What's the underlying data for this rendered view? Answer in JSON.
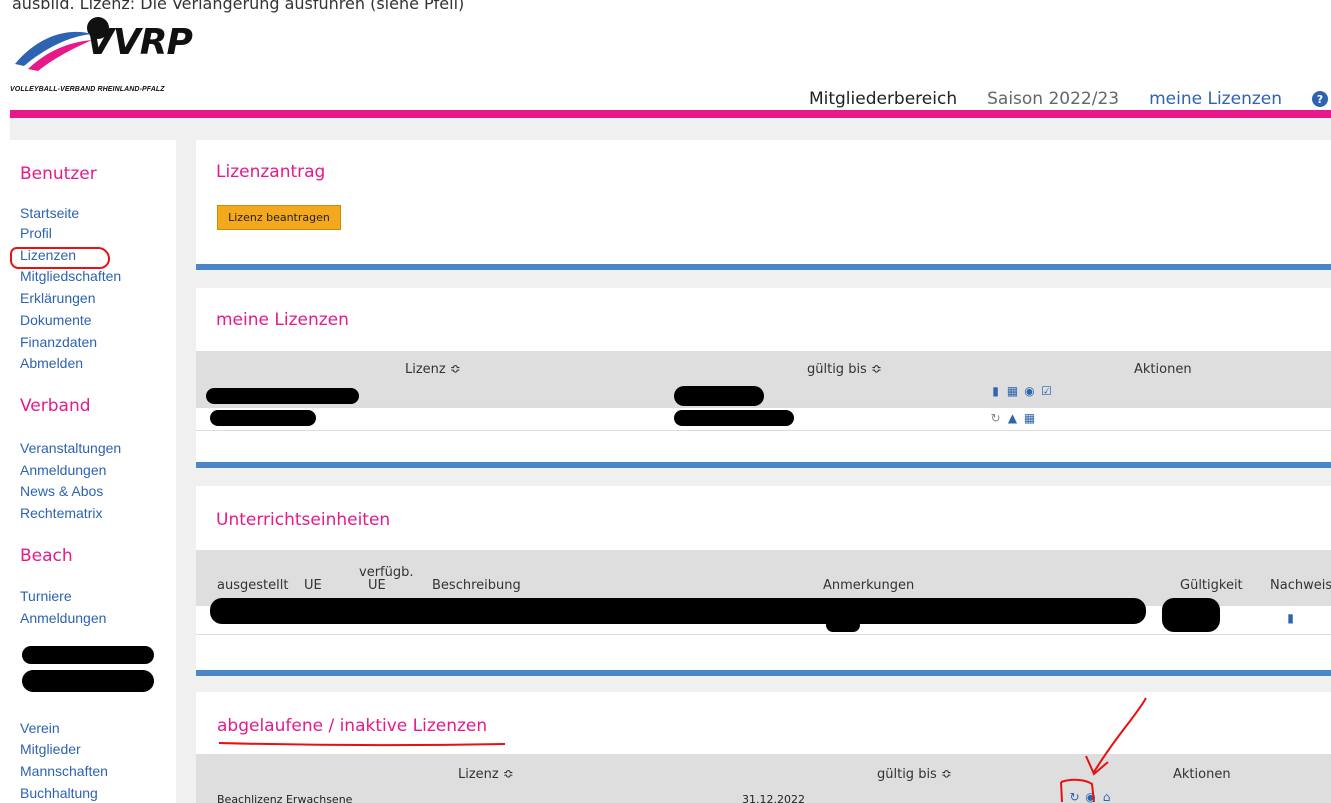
{
  "cutoff_text": "ausbild. Lizenz: Die Verlängerung ausführen (siehe Pfeil)",
  "header": {
    "logo_text": "VVRP",
    "logo_subtitle": "VOLLEYBALL-VERBAND RHEINLAND-PFALZ",
    "nav_members": "Mitgliederbereich",
    "nav_season": "Saison 2022/23",
    "nav_my_licenses": "meine Lizenzen",
    "help_icon_glyph": "?"
  },
  "colors": {
    "accent_pink": "#e7198a",
    "link_blue": "#2d63b0",
    "button_orange": "#f4a81d",
    "panel_border_blue": "#4a86c5"
  },
  "sidebar": {
    "section_user": "Benutzer",
    "user_links": [
      "Startseite",
      "Profil",
      "Lizenzen",
      "Mitgliedschaften",
      "Erklärungen",
      "Dokumente",
      "Finanzdaten",
      "Abmelden"
    ],
    "section_federation": "Verband",
    "federation_links": [
      "Veranstaltungen",
      "Anmeldungen",
      "News & Abos",
      "Rechtematrix"
    ],
    "section_beach": "Beach",
    "beach_links": [
      "Turniere",
      "Anmeldungen"
    ],
    "club_links": [
      "Verein",
      "Mitglieder",
      "Mannschaften",
      "Buchhaltung"
    ]
  },
  "license_request": {
    "title": "Lizenzantrag",
    "button_label": "Lizenz beantragen"
  },
  "my_licenses": {
    "title": "meine Lizenzen",
    "col_license": "Lizenz ≎",
    "col_valid_until": "gültig bis ≎",
    "col_actions": "Aktionen"
  },
  "lessons": {
    "title": "Unterrichtseinheiten",
    "col_issued": "ausgestellt",
    "col_ue": "UE",
    "col_available_line1": "verfügb.",
    "col_available_line2": "UE",
    "col_description": "Beschreibung",
    "col_notes": "Anmerkungen",
    "col_validity": "Gültigkeit",
    "col_proof": "Nachweis"
  },
  "expired_licenses": {
    "title": "abgelaufene / inaktive Lizenzen",
    "col_license": "Lizenz ≎",
    "col_valid_until": "gültig bis ≎",
    "col_actions": "Aktionen",
    "row1_license": "Beachlizenz Erwachsene",
    "row1_valid_until": "31.12.2022"
  }
}
